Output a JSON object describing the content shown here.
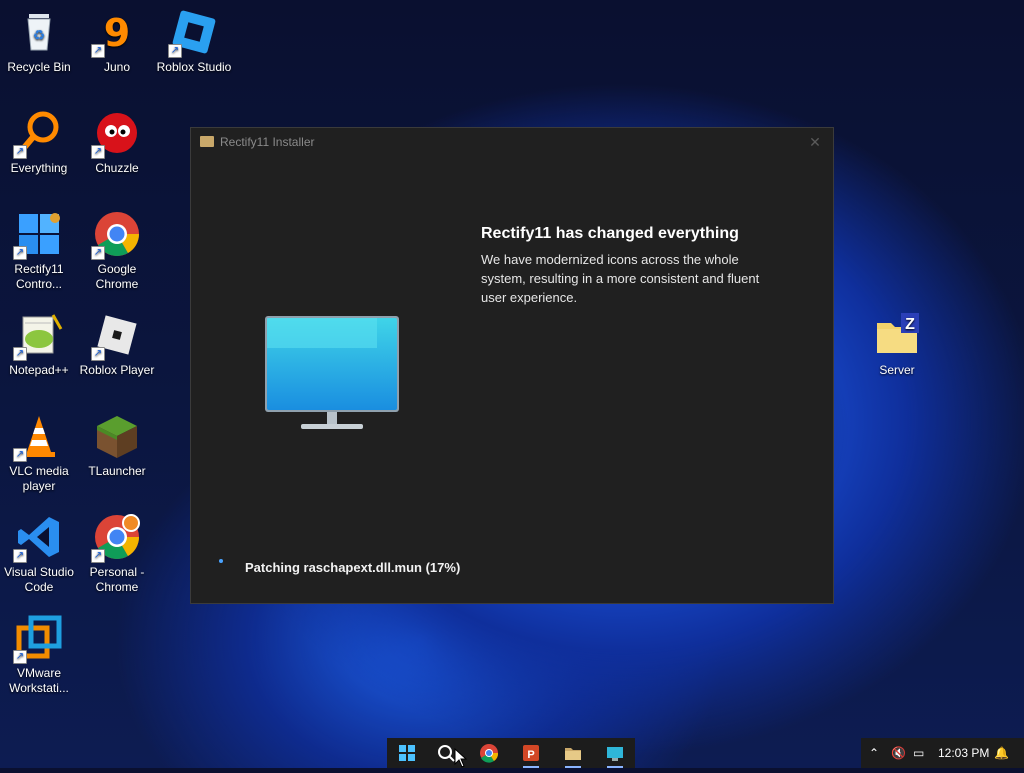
{
  "desktop": {
    "icons": [
      {
        "label": "Recycle Bin"
      },
      {
        "label": "Juno"
      },
      {
        "label": "Roblox Studio"
      },
      {
        "label": "Everything"
      },
      {
        "label": "Chuzzle"
      },
      {
        "label": "Rectify11 Contro..."
      },
      {
        "label": "Google Chrome"
      },
      {
        "label": "Notepad++"
      },
      {
        "label": "Roblox Player"
      },
      {
        "label": "VLC media player"
      },
      {
        "label": "TLauncher"
      },
      {
        "label": "Visual Studio Code"
      },
      {
        "label": "Personal - Chrome"
      },
      {
        "label": "VMware Workstati..."
      },
      {
        "label": "Server"
      }
    ]
  },
  "installer": {
    "title": "Rectify11 Installer",
    "headline": "Rectify11 has changed everything",
    "description": "We have modernized icons across the whole system, resulting in a more consistent and fluent user experience.",
    "status": "Patching raschapext.dll.mun (17%)",
    "progress_percent": 17
  },
  "taskbar": {
    "apps": [
      "start-icon",
      "search-icon",
      "chrome-icon",
      "powerpoint-icon",
      "file-explorer-icon",
      "rectify11-icon"
    ],
    "time": "12:03 PM"
  },
  "colors": {
    "window_bg": "#202020",
    "accent": "#1a5fd6",
    "taskbar_bg": "#1c1c1c"
  }
}
